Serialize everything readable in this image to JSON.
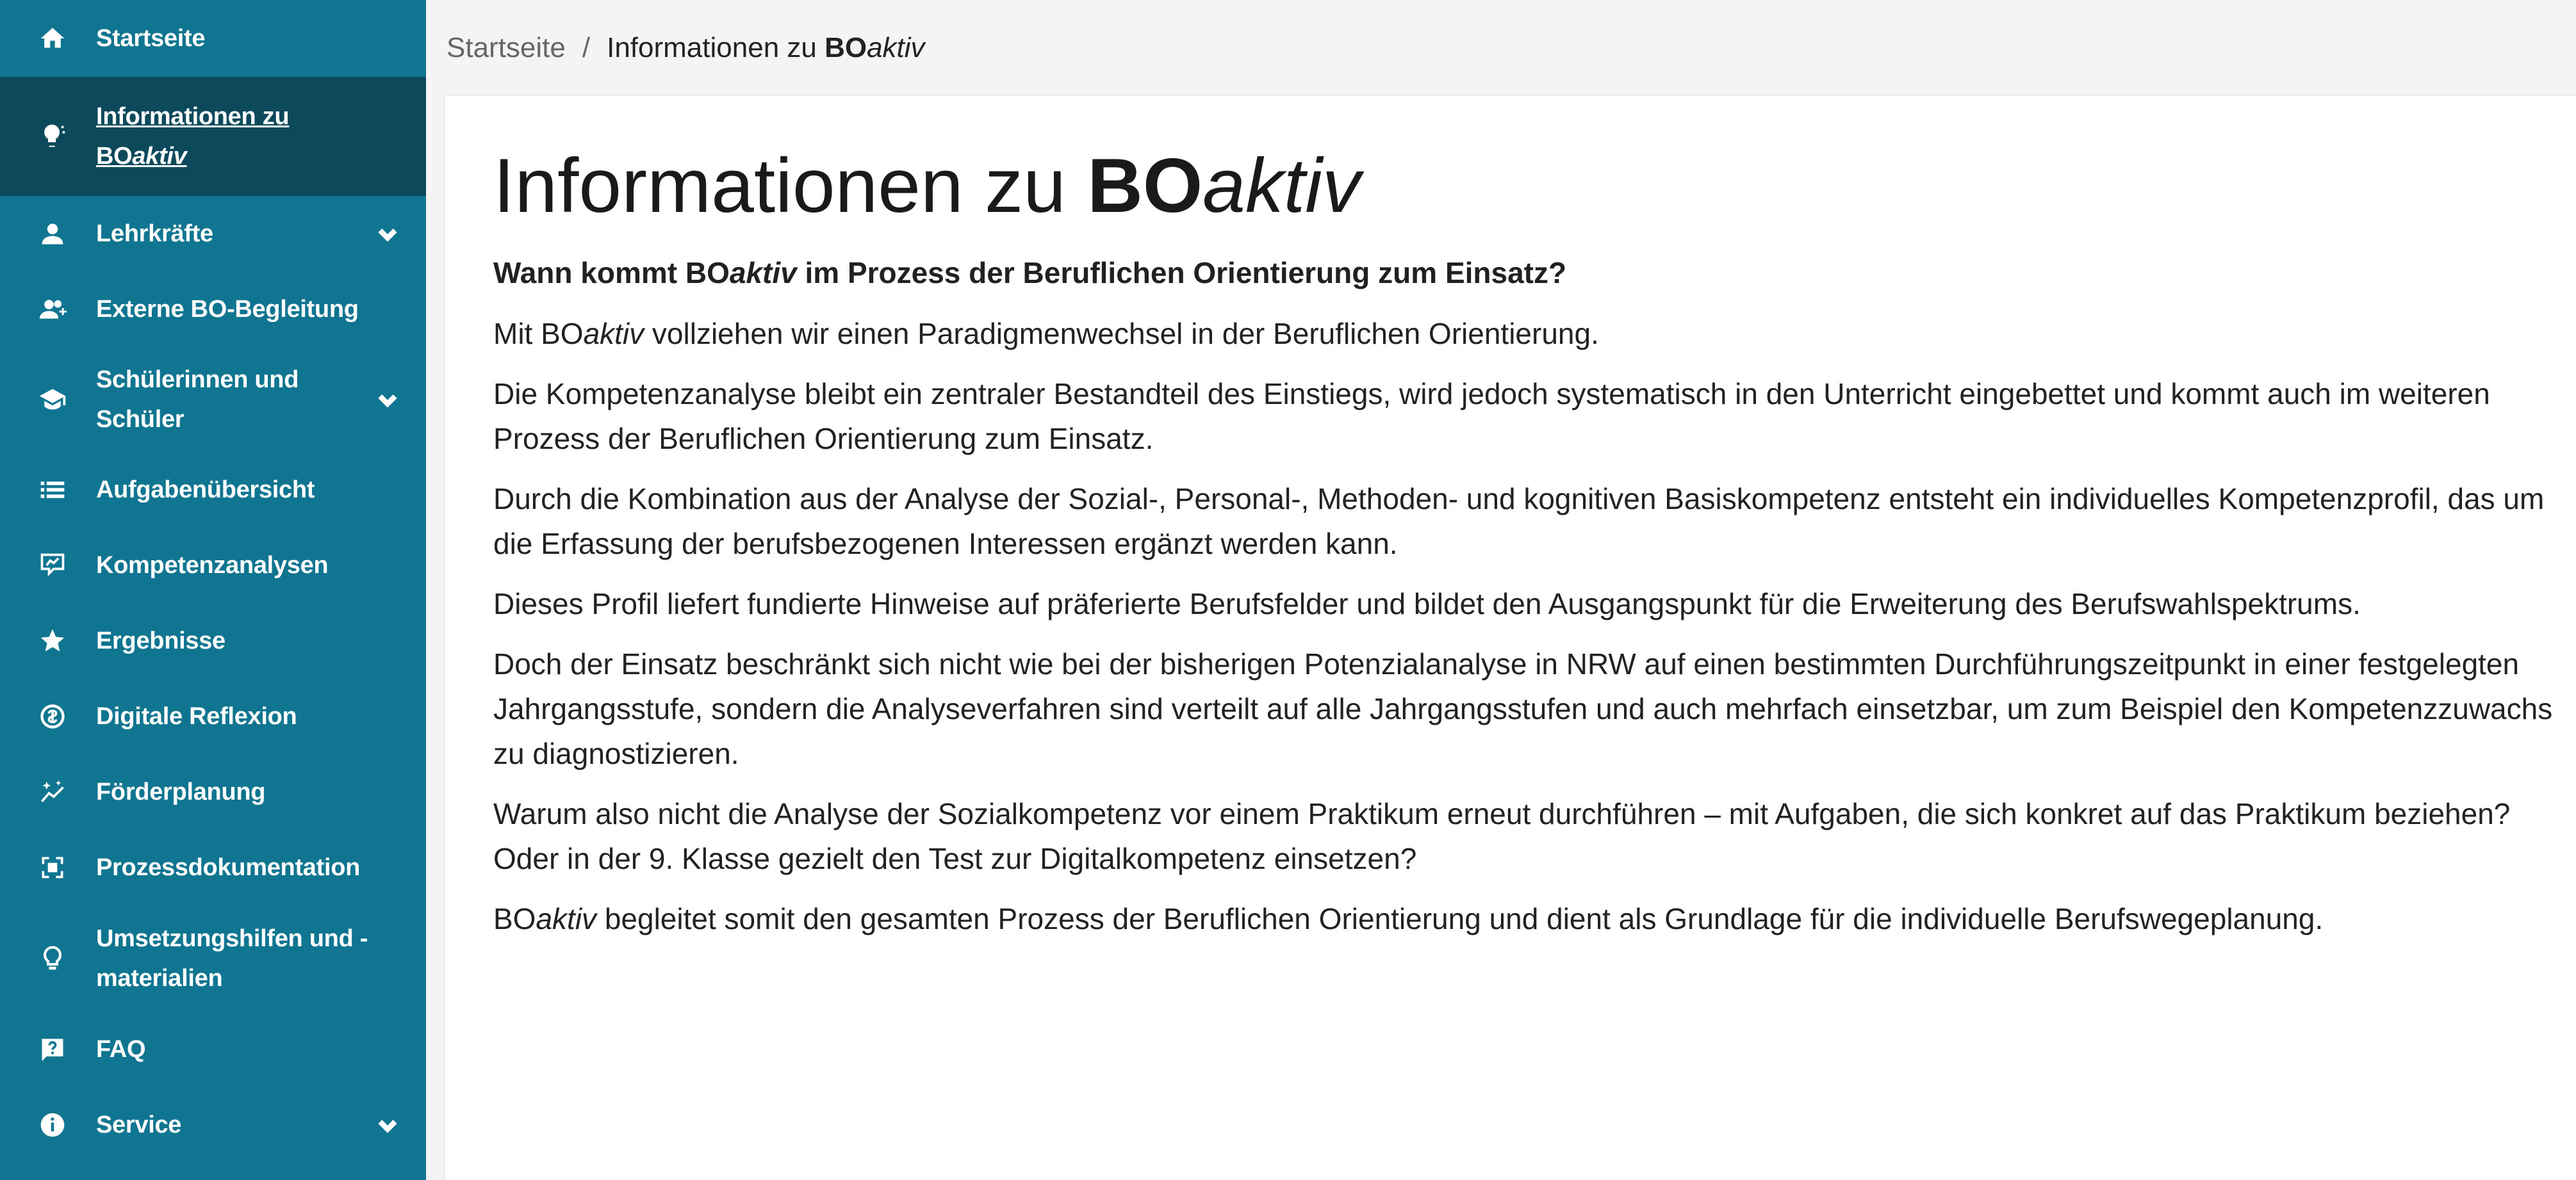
{
  "sidebar": {
    "items": [
      {
        "label": "Startseite",
        "icon": "home-icon",
        "active": false,
        "expandable": false
      },
      {
        "label_line1": "Informationen zu",
        "label_bo": "BO",
        "label_aktiv": "aktiv",
        "icon": "lightbulb-icon",
        "active": true,
        "expandable": false
      },
      {
        "label": "Lehrkräfte",
        "icon": "person-icon",
        "active": false,
        "expandable": true
      },
      {
        "label": "Externe BO-Begleitung",
        "icon": "person-add-icon",
        "active": false,
        "expandable": false
      },
      {
        "label_line1": "Schülerinnen und",
        "label_line2": "Schüler",
        "icon": "graduation-cap-icon",
        "active": false,
        "expandable": true
      },
      {
        "label": "Aufgabenübersicht",
        "icon": "list-icon",
        "active": false,
        "expandable": false
      },
      {
        "label": "Kompetenzanalysen",
        "icon": "analysis-icon",
        "active": false,
        "expandable": false
      },
      {
        "label": "Ergebnisse",
        "icon": "star-icon",
        "active": false,
        "expandable": false
      },
      {
        "label": "Digitale Reflexion",
        "icon": "reflection-icon",
        "active": false,
        "expandable": false
      },
      {
        "label": "Förderplanung",
        "icon": "sparkle-chart-icon",
        "active": false,
        "expandable": false
      },
      {
        "label": "Prozessdokumentation",
        "icon": "document-scan-icon",
        "active": false,
        "expandable": false
      },
      {
        "label_line1": "Umsetzungshilfen und -",
        "label_line2": "materialien",
        "icon": "bulb-outline-icon",
        "active": false,
        "expandable": false
      },
      {
        "label": "FAQ",
        "icon": "faq-icon",
        "active": false,
        "expandable": false
      },
      {
        "label": "Service",
        "icon": "info-icon",
        "active": false,
        "expandable": true
      }
    ],
    "colors": {
      "background": "#0f7590",
      "active": "#0b495b",
      "text": "#ffffff"
    }
  },
  "breadcrumb": {
    "home": "Startseite",
    "separator": "/",
    "current_prefix": "Informationen zu ",
    "current_bo": "BO",
    "current_aktiv": "aktiv"
  },
  "main": {
    "title_prefix": "Informationen zu ",
    "title_bo": "BO",
    "title_aktiv": "aktiv",
    "subtitle_prefix": "Wann kommt BO",
    "subtitle_aktiv": "aktiv",
    "subtitle_suffix": " im Prozess der Beruflichen Orientierung zum Einsatz?",
    "p1_prefix": "Mit BO",
    "p1_aktiv": "aktiv",
    "p1_suffix": " vollziehen wir einen Paradigmenwechsel in der Beruflichen Orientierung.",
    "p2": "Die Kompetenzanalyse bleibt ein zentraler Bestandteil des Einstiegs, wird jedoch systematisch in den Unterricht eingebettet und kommt auch im weiteren Prozess der Beruflichen Orientierung zum Einsatz.",
    "p3": "Durch die Kombination aus der Analyse der Sozial-, Personal-, Methoden- und kognitiven Basiskompetenz entsteht ein individuelles Kompetenzprofil, das um die Erfassung der berufsbezogenen Interessen ergänzt werden kann.",
    "p4": "Dieses Profil liefert fundierte Hinweise auf präferierte Berufsfelder und bildet den Ausgangspunkt für die Erweiterung des Berufswahlspektrums.",
    "p5": "Doch der Einsatz beschränkt sich nicht wie bei der bisherigen Potenzialanalyse in NRW auf einen bestimmten Durchführungszeitpunkt in einer festgelegten Jahrgangsstufe, sondern die Analyseverfahren sind verteilt auf alle Jahrgangsstufen und auch mehrfach einsetzbar, um zum Beispiel den Kompetenzzuwachs zu diagnostizieren.",
    "p6": "Warum also nicht die Analyse der Sozialkompetenz vor einem Praktikum erneut durchführen – mit Aufgaben, die sich konkret auf das Praktikum beziehen? Oder in der 9. Klasse gezielt den Test zur Digitalkompetenz einsetzen?",
    "p7_prefix": "BO",
    "p7_aktiv": "aktiv",
    "p7_suffix": " begleitet somit den gesamten Prozess der Beruflichen Orientierung und dient als Grundlage für die individuelle Berufswegeplanung."
  }
}
